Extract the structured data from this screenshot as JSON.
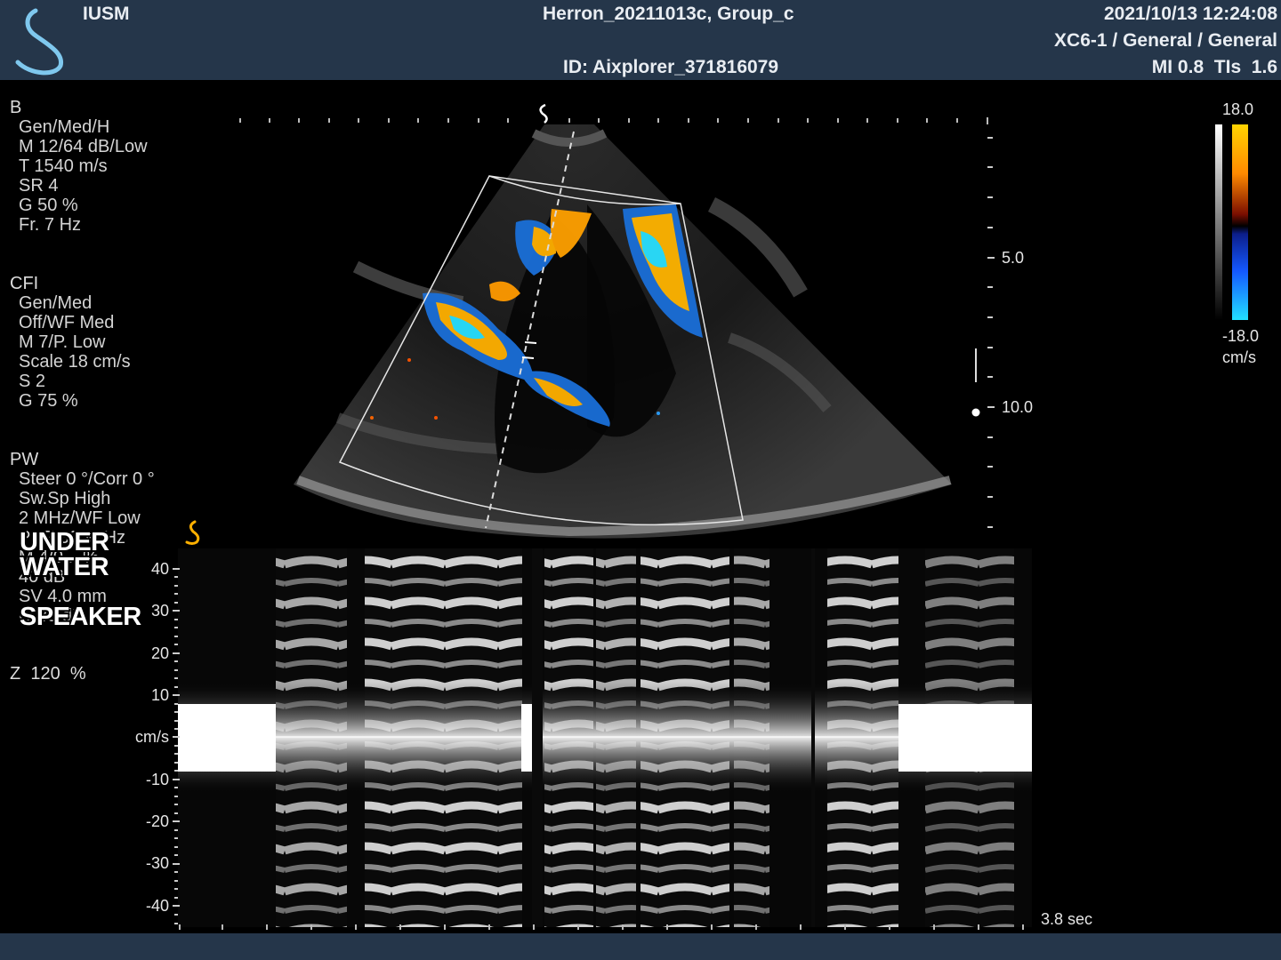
{
  "header": {
    "institution": "IUSM",
    "patient": "Herron_20211013c, Group_c",
    "exam_id": "ID: Aixplorer_371816079",
    "datetime": "2021/10/13 12:24:08",
    "probe": "XC6-1 / General / General",
    "indices": "MI 0.8  TIs  1.6",
    "logo_icon": "supersonic-logo-icon"
  },
  "bmode_params": {
    "title": "B",
    "items": [
      "Gen/Med/H",
      "M 12/64 dB/Low",
      "T 1540 m/s",
      "SR 4",
      "G 50 %",
      "Fr. 7 Hz"
    ]
  },
  "cfi_params": {
    "title": "CFI",
    "items": [
      "Gen/Med",
      "Off/WF Med",
      "M 7/P. Low",
      "Scale 18 cm/s",
      "S 2",
      "G 75 %"
    ]
  },
  "pw_params": {
    "title": "PW",
    "items": [
      "Steer 0 °/Corr 0 °",
      "Sw.Sp High",
      "2 MHz/WF Low",
      "PRF 3000 Hz",
      "M 4/0 .. %",
      "40 dB",
      "SV 4.0 mm",
      "G 35 dB"
    ]
  },
  "zoom": "Z  120  %",
  "overlay_text": [
    "UNDER",
    "WATER",
    "SPEAKER"
  ],
  "depth_scale": {
    "label_5": "5.0",
    "label_10": "10.0"
  },
  "color_scale": {
    "max": "18.0",
    "min": "-18.0",
    "unit": "cm/s",
    "pos_color": "#ffd400",
    "neg_color": "#22e0ff"
  },
  "spectral": {
    "velocity_labels": [
      "40",
      "30",
      "20",
      "10",
      "cm/s",
      "-10",
      "-20",
      "-30",
      "-40"
    ],
    "sweep_time": "3.8 sec"
  }
}
